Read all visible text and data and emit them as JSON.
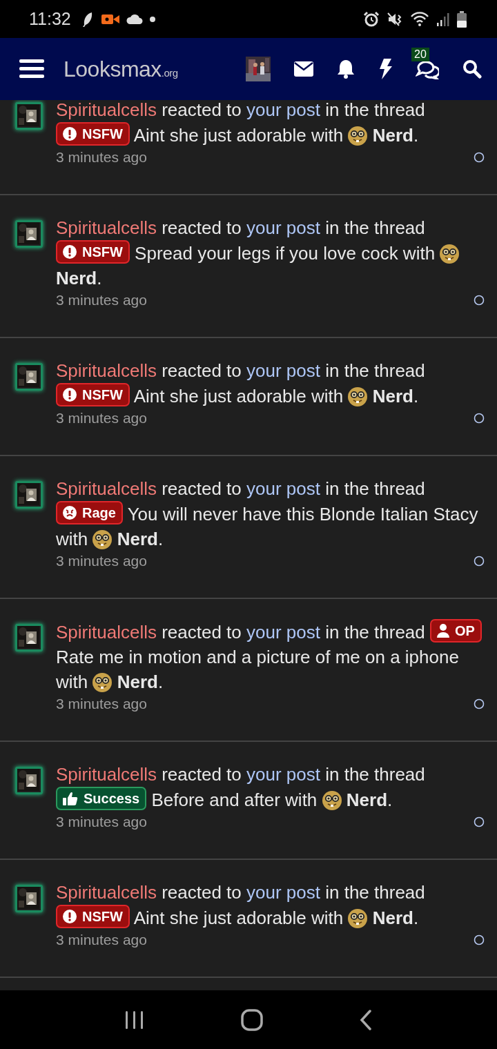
{
  "status_bar": {
    "time": "11:32"
  },
  "header": {
    "logo": "Looksmax",
    "logo_suffix": ".org",
    "conversations_badge": "20"
  },
  "notifications": [
    {
      "user": "Spiritualcells",
      "action": "reacted to",
      "target": "your post",
      "context": "in the thread",
      "prefix": {
        "kind": "nsfw",
        "label": "NSFW"
      },
      "thread": "Aint she just adorable with",
      "reaction": "**Nerd**.",
      "time": "3 minutes ago"
    },
    {
      "user": "Spiritualcells",
      "action": "reacted to",
      "target": "your post",
      "context": "in the thread",
      "prefix": {
        "kind": "nsfw",
        "label": "NSFW"
      },
      "thread": "Spread your legs if you love cock with",
      "reaction": "**Nerd**.",
      "time": "3 minutes ago"
    },
    {
      "user": "Spiritualcells",
      "action": "reacted to",
      "target": "your post",
      "context": "in the thread",
      "prefix": {
        "kind": "nsfw",
        "label": "NSFW"
      },
      "thread": "Aint she just adorable with",
      "reaction": "**Nerd**.",
      "time": "3 minutes ago"
    },
    {
      "user": "Spiritualcells",
      "action": "reacted to",
      "target": "your post",
      "context": "in the thread",
      "prefix": {
        "kind": "rage",
        "label": "Rage"
      },
      "thread": "You will never have this Blonde Italian Stacy with",
      "reaction": "**Nerd**.",
      "time": "3 minutes ago"
    },
    {
      "user": "Spiritualcells",
      "action": "reacted to",
      "target": "your post",
      "context": "in the thread",
      "prefix": {
        "kind": "op",
        "label": "OP"
      },
      "thread": "Rate me in motion and a picture of me on a iphone with",
      "reaction": "**Nerd**.",
      "time": "3 minutes ago"
    },
    {
      "user": "Spiritualcells",
      "action": "reacted to",
      "target": "your post",
      "context": "in the thread",
      "prefix": {
        "kind": "success",
        "label": "Success"
      },
      "thread": "Before and after with",
      "reaction": "**Nerd**.",
      "time": "3 minutes ago"
    },
    {
      "user": "Spiritualcells",
      "action": "reacted to",
      "target": "your post",
      "context": "in the thread",
      "prefix": {
        "kind": "nsfw",
        "label": "NSFW"
      },
      "thread": "Aint she just adorable with",
      "reaction": "**Nerd**.",
      "time": "3 minutes ago"
    }
  ]
}
